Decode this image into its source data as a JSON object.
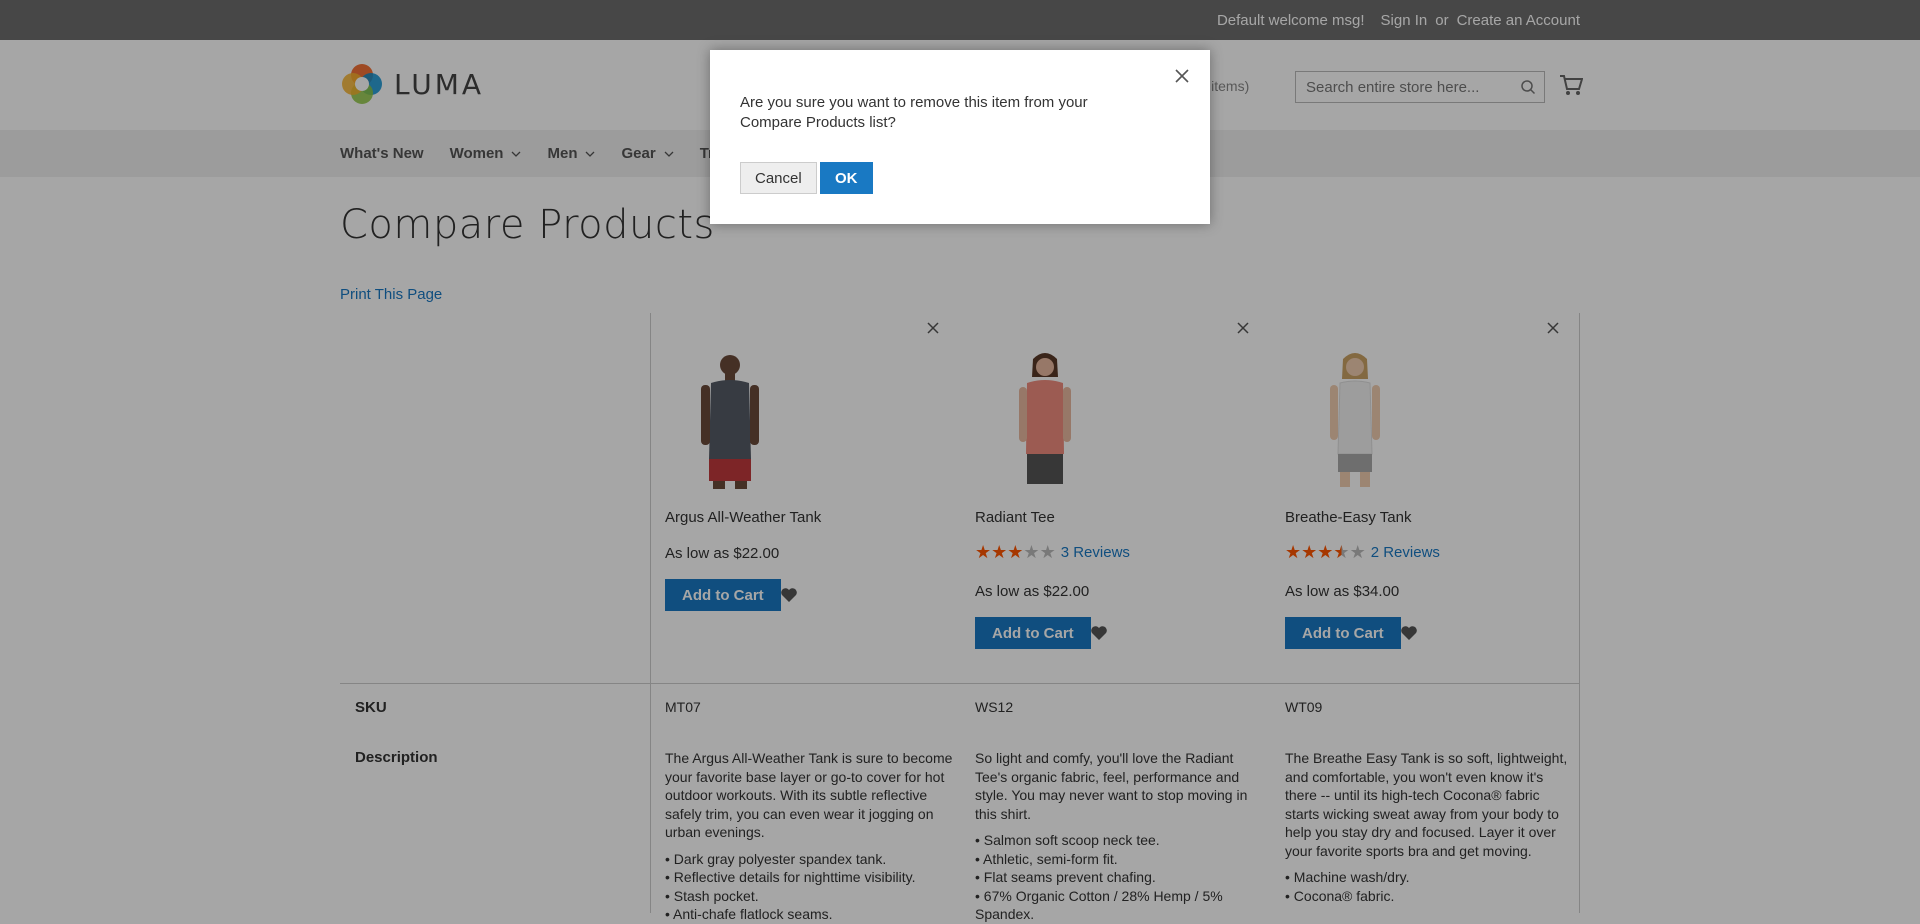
{
  "topbar": {
    "welcome": "Default welcome msg!",
    "sign_in": "Sign In",
    "or": "or",
    "create_account": "Create an Account"
  },
  "header": {
    "logo_text": "LUMA",
    "compare_label": "ts",
    "compare_count": "(3 items)",
    "search_placeholder": "Search entire store here..."
  },
  "nav": {
    "items": [
      {
        "label": "What's New"
      },
      {
        "label": "Women"
      },
      {
        "label": "Men"
      },
      {
        "label": "Gear"
      },
      {
        "label": "Tr"
      }
    ]
  },
  "page": {
    "title": "Compare Products",
    "print_link": "Print This Page"
  },
  "products": [
    {
      "name": "Argus All-Weather Tank",
      "price": "As low as $22.00",
      "add_to_cart": "Add to Cart",
      "sku": "MT07",
      "description": "The Argus All-Weather Tank is sure to become your favorite base layer or go-to cover for hot outdoor workouts. With its subtle reflective safely trim, you can even wear it jogging on urban evenings.",
      "bullets": [
        "Dark gray polyester spandex tank.",
        "Reflective details for nighttime visibility.",
        "Stash pocket.",
        "Anti-chafe flatlock seams."
      ]
    },
    {
      "name": "Radiant Tee",
      "rating": 3,
      "reviews": "3 Reviews",
      "price": "As low as $22.00",
      "add_to_cart": "Add to Cart",
      "sku": "WS12",
      "description": "So light and comfy, you'll love the Radiant Tee's organic fabric, feel, performance and style. You may never want to stop moving in this shirt.",
      "bullets": [
        "Salmon soft scoop neck tee.",
        "Athletic, semi-form fit.",
        "Flat seams prevent chafing.",
        "67% Organic Cotton / 28% Hemp / 5% Spandex."
      ]
    },
    {
      "name": "Breathe-Easy Tank",
      "rating": 3.5,
      "reviews": "2 Reviews",
      "price": "As low as $34.00",
      "add_to_cart": "Add to Cart",
      "sku": "WT09",
      "description": "The Breathe Easy Tank is so soft, lightweight, and comfortable, you won't even know it's there -- until its high-tech Cocona® fabric starts wicking sweat away from your body to help you stay dry and focused. Layer it over your favorite sports bra and get moving.",
      "bullets": [
        "Machine wash/dry.",
        "Cocona® fabric."
      ]
    }
  ],
  "rows": {
    "sku_label": "SKU",
    "description_label": "Description"
  },
  "modal": {
    "message": "Are you sure you want to remove this item from your Compare Products list?",
    "cancel": "Cancel",
    "ok": "OK"
  },
  "colors": {
    "primary": "#1979c3",
    "star": "#ff5501"
  }
}
